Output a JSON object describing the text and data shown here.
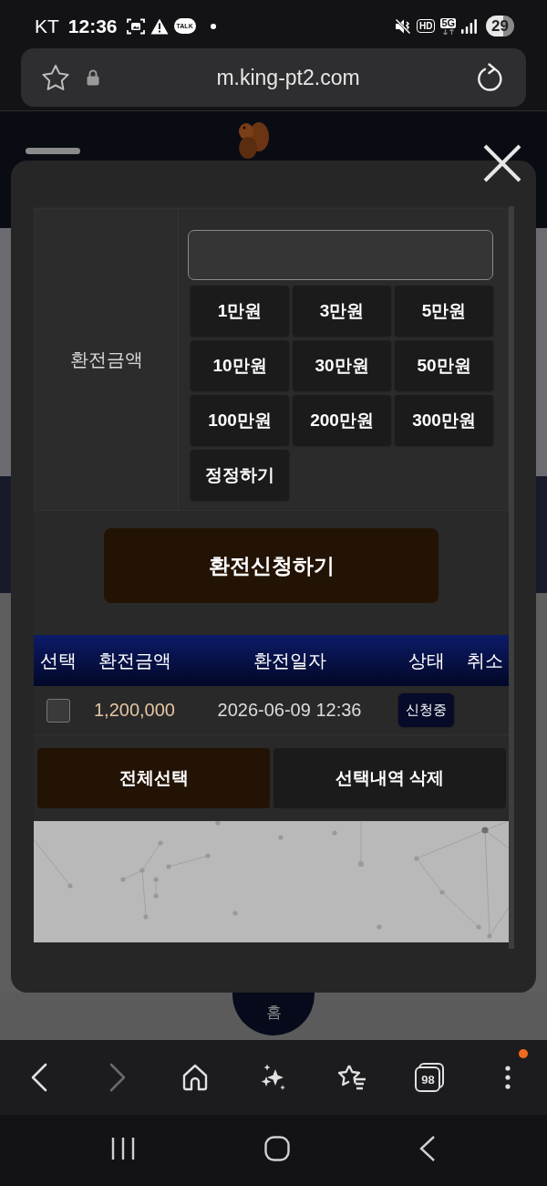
{
  "status_bar": {
    "carrier": "KT",
    "time": "12:36",
    "chat_badge": "TALK",
    "hd_label": "HD",
    "network_label": "5G",
    "battery": "29"
  },
  "address_bar": {
    "url": "m.king-pt2.com"
  },
  "site": {
    "home_label": "홈"
  },
  "modal": {
    "amount_label": "환전금액",
    "amount_buttons": [
      "1만원",
      "3만원",
      "5만원",
      "10만원",
      "30만원",
      "50만원",
      "100만원",
      "200만원",
      "300만원",
      "정정하기"
    ],
    "submit_button": "환전신청하기",
    "table": {
      "columns": [
        "선택",
        "환전금액",
        "환전일자",
        "상태",
        "취소"
      ],
      "rows": [
        {
          "checked": false,
          "amount": "1,200,000",
          "date": "2026-06-09 12:36",
          "status": "신청중"
        }
      ]
    },
    "actions": [
      {
        "label": "전체선택",
        "kind": "primary"
      },
      {
        "label": "선택내역 삭제",
        "kind": "secondary"
      }
    ]
  },
  "browser_toolbar": {
    "forward_disabled": true,
    "tabs_count": "98",
    "menu_badge": true
  }
}
